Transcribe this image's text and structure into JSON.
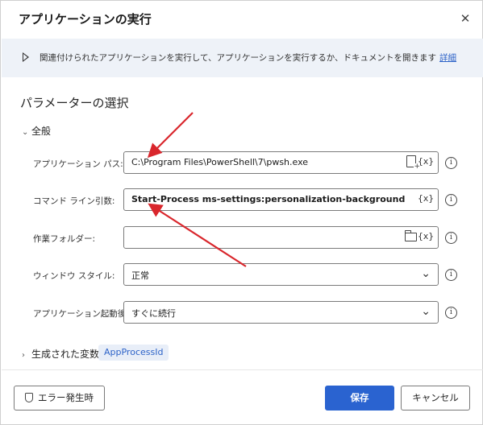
{
  "dialog": {
    "title": "アプリケーションの実行",
    "close_symbol": "✕"
  },
  "info": {
    "text": "関連付けられたアプリケーションを実行して、アプリケーションを実行するか、ドキュメントを開きます",
    "link": "詳細"
  },
  "section": {
    "title": "パラメーターの選択",
    "group": "全般"
  },
  "fields": {
    "app_path": {
      "label": "アプリケーション パス:",
      "value": "C:\\Program Files\\PowerShell\\7\\pwsh.exe"
    },
    "args": {
      "label": "コマンド ライン引数:",
      "value": "Start-Process ms-settings:personalization-background"
    },
    "workdir": {
      "label": "作業フォルダー:",
      "value": ""
    },
    "window_style": {
      "label": "ウィンドウ スタイル:",
      "value": "正常"
    },
    "after_launch": {
      "label": "アプリケーション起動後:",
      "value": "すぐに続行"
    }
  },
  "fx_label": "{x}",
  "help_symbol": "i",
  "generated": {
    "label": "生成された変数",
    "variable": "AppProcessId"
  },
  "buttons": {
    "error": "エラー発生時",
    "save": "保存",
    "cancel": "キャンセル"
  },
  "colors": {
    "accent": "#2a63d0",
    "annotation_arrow": "#d9262c",
    "info_bar": "#eef2f8"
  }
}
